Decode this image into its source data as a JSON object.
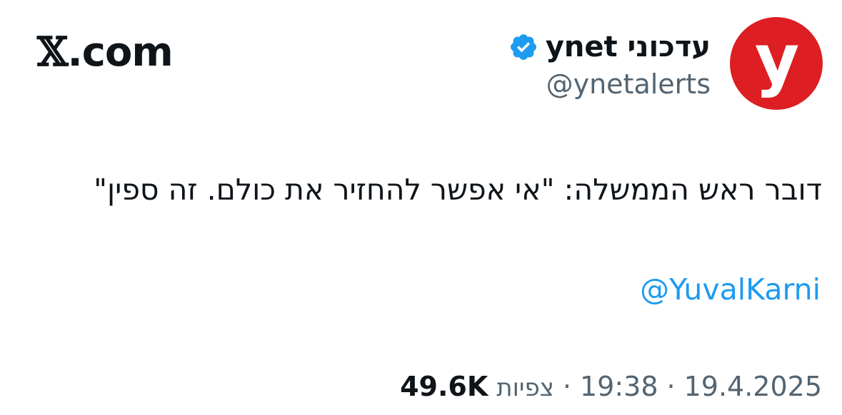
{
  "brand": {
    "logo_mark": "𝕏",
    "logo_text": ".com"
  },
  "author": {
    "display_name": "עדכוני ynet",
    "handle": "@ynetalerts",
    "verified": true,
    "avatar_letter": "y",
    "avatar_color": "#dd1e22"
  },
  "tweet": {
    "text": "דובר ראש הממשלה: \"אי אפשר להחזיר את כולם. זה ספין\"",
    "mention": "@YuvalKarni"
  },
  "meta": {
    "views_count": "49.6K",
    "views_label": "צפיות",
    "time": "19:38",
    "date": "19.4.2025",
    "separator": "·"
  },
  "colors": {
    "text": "#0f1419",
    "secondary": "#536471",
    "link": "#1d9bf0",
    "verified_badge": "#1d9bf0"
  }
}
